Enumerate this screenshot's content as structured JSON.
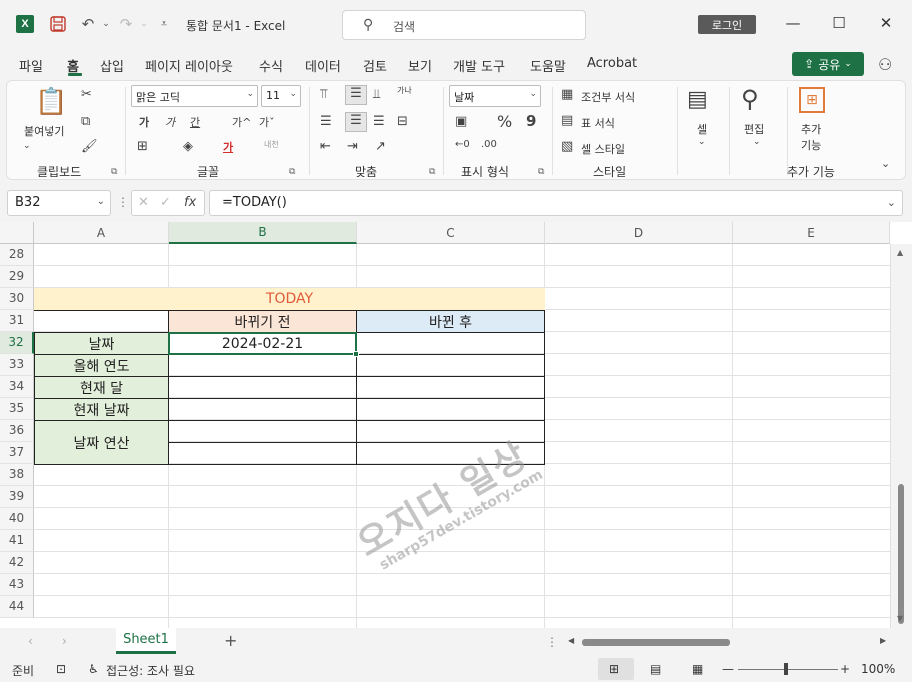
{
  "app": {
    "logo_letter": "X",
    "title": "통합 문서1  -  Excel",
    "search_placeholder": "검색",
    "login_label": "로그인",
    "minimize": "—",
    "maximize": "☐",
    "close": "✕"
  },
  "menu": {
    "tabs": [
      "파일",
      "홈",
      "삽입",
      "페이지 레이아웃",
      "수식",
      "데이터",
      "검토",
      "보기",
      "개발 도구",
      "도움말",
      "Acrobat"
    ],
    "active": "홈",
    "share_label": "공유"
  },
  "ribbon": {
    "clipboard": {
      "paste_label": "붙여넣기",
      "group_label": "클립보드"
    },
    "font": {
      "font_name": "맑은 고딕",
      "font_size": "11",
      "group_label": "글꼴",
      "bold": "가",
      "italic": "가",
      "underline": "간",
      "grow": "가^",
      "shrink": "가ˇ",
      "color_letter": "가",
      "phonetic": "내천"
    },
    "alignment": {
      "group_label": "맞춤",
      "wrap": "가나"
    },
    "number": {
      "format": "날짜",
      "group_label": "표시 형식",
      "percent": "%",
      "comma": "9"
    },
    "styles": {
      "conditional": "조건부 서식",
      "table": "표 서식",
      "cell_styles": "셀 스타일",
      "group_label": "스타일"
    },
    "cells": {
      "label": "셀"
    },
    "editing": {
      "label": "편집"
    },
    "addins": {
      "label1": "추가",
      "label2": "기능",
      "group_label": "추가 기능"
    }
  },
  "formula_bar": {
    "name_box": "B32",
    "fx": "fx",
    "formula": "=TODAY()"
  },
  "sheet": {
    "columns": [
      "A",
      "B",
      "C",
      "D",
      "E"
    ],
    "rows": [
      "28",
      "29",
      "30",
      "31",
      "32",
      "33",
      "34",
      "35",
      "36",
      "37",
      "38",
      "39",
      "40",
      "41",
      "42",
      "43",
      "44"
    ],
    "selected_col": "B",
    "selected_row": "32",
    "title_cell": "TODAY",
    "header_before": "바뀌기 전",
    "header_after": "바뀐 후",
    "labels": [
      "날짜",
      "올해 연도",
      "현재 달",
      "현재 날짜",
      "날짜 연산"
    ],
    "b32_value": "2024-02-21",
    "colors": {
      "title_bg": "#fff2cc",
      "title_text": "#e05a3a",
      "before_bg": "#fbe5d6",
      "after_bg": "#ddebf7",
      "label_bg": "#e2efda",
      "accent": "#1e7145"
    }
  },
  "watermark": {
    "line1": "오지다 일상",
    "line2": "sharp57dev.tistory.com"
  },
  "tabs_bar": {
    "sheet_name": "Sheet1",
    "add": "+"
  },
  "status": {
    "ready": "준비",
    "accessibility": "접근성: 조사 필요",
    "zoom": "100%",
    "zoom_minus": "—",
    "zoom_plus": "+"
  }
}
